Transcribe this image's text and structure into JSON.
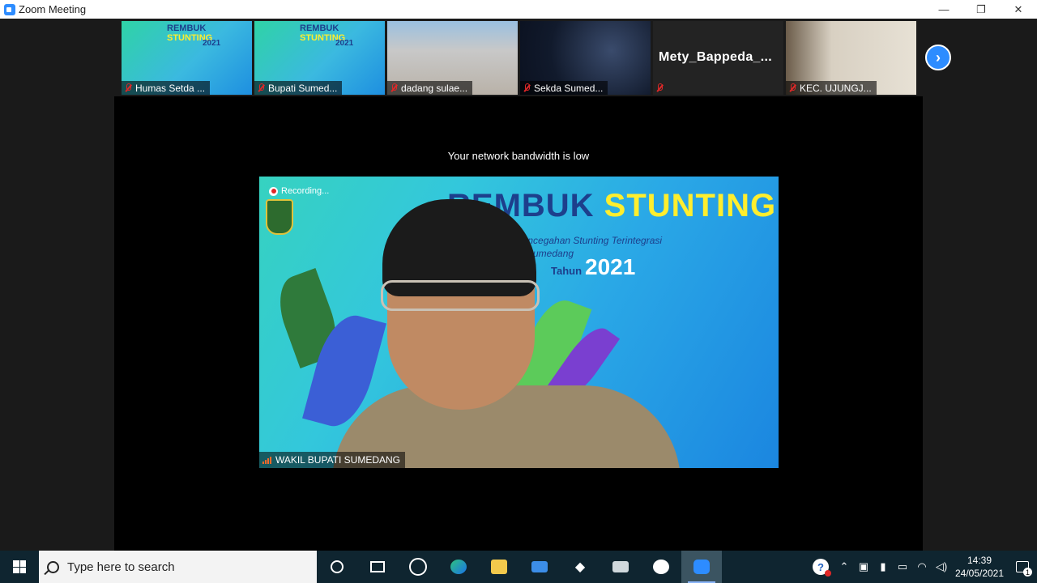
{
  "window": {
    "title": "Zoom Meeting",
    "minimize": "—",
    "restore": "❐",
    "close": "✕"
  },
  "thumbnails": [
    {
      "name": "Humas Setda ...",
      "muted": true,
      "bg": "stunting"
    },
    {
      "name": "Bupati Sumed...",
      "muted": true,
      "bg": "stunting"
    },
    {
      "name": "dadang sulae...",
      "muted": true,
      "bg": "building"
    },
    {
      "name": "Sekda Sumed...",
      "muted": true,
      "bg": "space"
    },
    {
      "name": "",
      "big_name": "Mety_Bappeda_...",
      "muted": true,
      "bg": "dark"
    },
    {
      "name": "KEC. UJUNGJ...",
      "muted": true,
      "bg": "room"
    }
  ],
  "thumb_banner": {
    "title_a": "REMBUK ",
    "title_b": "STUNTING",
    "year": "2021"
  },
  "next_button": "›",
  "stage": {
    "network_message": "Your network bandwidth is low",
    "recording_label": "Recording...",
    "banner_title_a": "REMBUK ",
    "banner_title_b": "STUNTING",
    "banner_subtitle": "an Pencegahan Stunting Terintegrasi",
    "banner_subtitle2": "Sumedang",
    "banner_year_small": "Tahun",
    "banner_year": "2021",
    "speaker_name": "WAKIL BUPATI SUMEDANG"
  },
  "taskbar": {
    "search_placeholder": "Type here to search",
    "apps": [
      "cortana-icon",
      "task-view-icon",
      "zoom-outline-icon",
      "edge-icon",
      "file-explorer-icon",
      "mail-icon",
      "dropbox-icon",
      "camera-icon",
      "whatsapp-icon",
      "zoom-icon"
    ],
    "clock_time": "14:39",
    "clock_date": "24/05/2021",
    "notification_count": "1",
    "help_label": "?"
  }
}
